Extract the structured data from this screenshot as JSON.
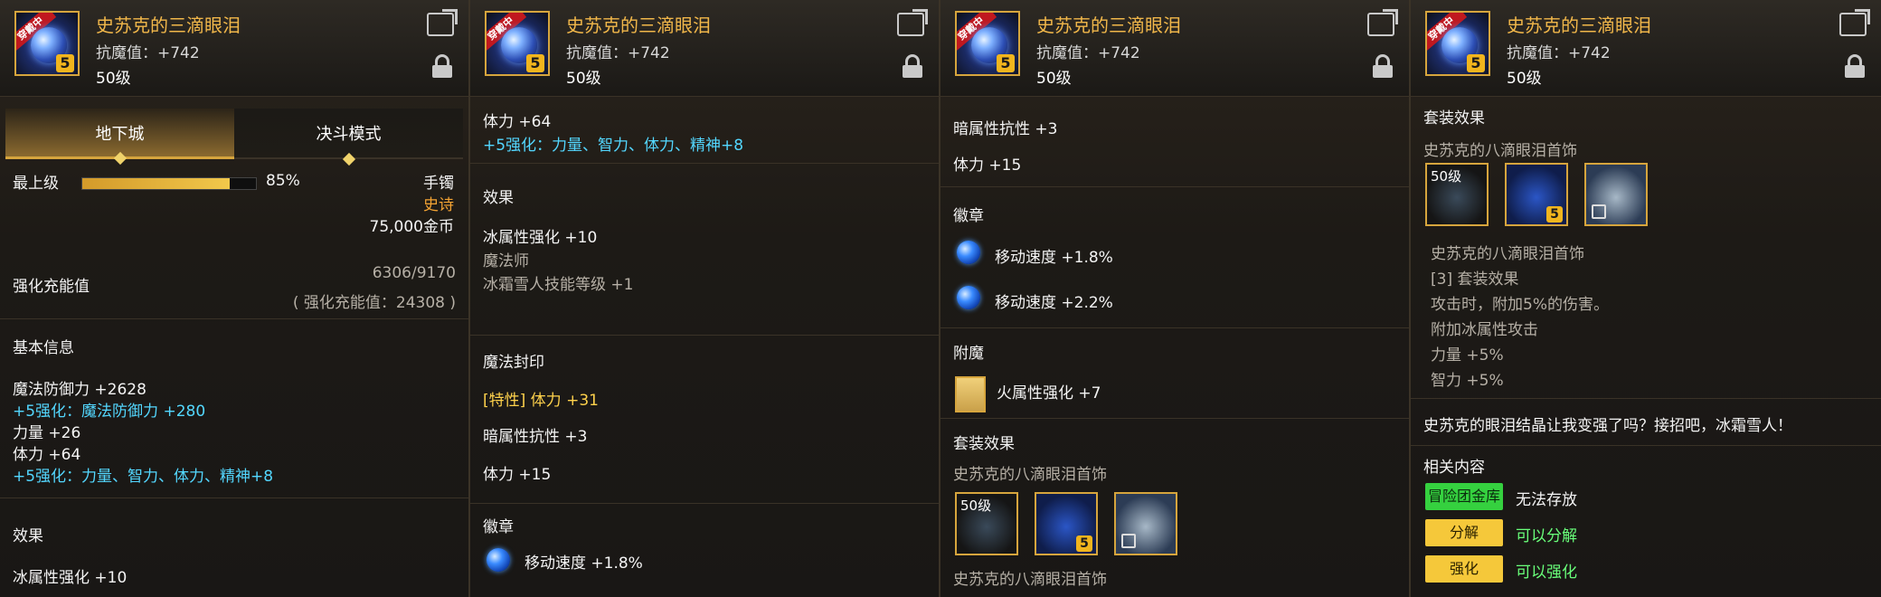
{
  "panels": [
    {
      "header": {
        "title": "史苏克的三滴眼泪",
        "resist": "抗魔值：+742",
        "level": "50级"
      },
      "tabs": [
        "地下城",
        "决斗模式"
      ],
      "grade": {
        "label": "最上级",
        "percent_text": "85%",
        "value": 0.85
      },
      "side_info": {
        "type": "手镯",
        "rarity": "史诗",
        "price": "75,000金币"
      },
      "charge": {
        "label": "强化充能值",
        "value": "6306/9170",
        "sub": "( 强化充能值：24308 )"
      },
      "sections": {
        "basic_title": "基本信息",
        "lines": [
          "魔法防御力 +2628",
          "+5强化：魔法防御力 +280",
          "力量 +26",
          "体力 +64",
          "+5强化：力量、智力、体力、精神+8"
        ],
        "effect_title": "效果",
        "effect_line": "冰属性强化 +10"
      }
    },
    {
      "header": {
        "title": "史苏克的三滴眼泪",
        "resist": "抗魔值：+742",
        "level": "50级"
      },
      "lines_top": [
        "体力 +64",
        "+5强化：力量、智力、体力、精神+8"
      ],
      "effect_title": "效果",
      "effect_lines": [
        "冰属性强化 +10",
        "魔法师",
        "冰霜雪人技能等级 +1"
      ],
      "seal_title": "魔法封印",
      "seal_lines": [
        "[特性] 体力 +31",
        "暗属性抗性 +3",
        "体力 +15"
      ],
      "badge_title": "徽章",
      "badge_line": "移动速度 +1.8%"
    },
    {
      "header": {
        "title": "史苏克的三滴眼泪",
        "resist": "抗魔值：+742",
        "level": "50级"
      },
      "lines_top": [
        "暗属性抗性 +3",
        "体力 +15"
      ],
      "badge_title": "徽章",
      "badge_lines": [
        "移动速度 +1.8%",
        "移动速度 +2.2%"
      ],
      "enchant_title": "附魔",
      "enchant_line": "火属性强化 +7",
      "set_title": "套装效果",
      "set_name": "史苏克的八滴眼泪首饰",
      "set_item_label": "50级",
      "set_item_name": "史苏克的八滴眼泪首饰"
    },
    {
      "header": {
        "title": "史苏克的三滴眼泪",
        "resist": "抗魔值：+742",
        "level": "50级"
      },
      "set_title": "套装效果",
      "set_name": "史苏克的八滴眼泪首饰",
      "set_item_label": "50级",
      "set_lines": [
        "史苏克的八滴眼泪首饰",
        "[3] 套装效果",
        "攻击时，附加5%的伤害。",
        "附加冰属性攻击",
        "力量 +5%",
        "智力 +5%"
      ],
      "quote": "史苏克的眼泪结晶让我变强了吗？接招吧，冰霜雪人！",
      "related_title": "相关内容",
      "buttons": [
        {
          "label": "冒险团金库",
          "desc": "无法存放"
        },
        {
          "label": "分解",
          "desc": "可以分解"
        },
        {
          "label": "强化",
          "desc": "可以强化"
        }
      ]
    }
  ]
}
